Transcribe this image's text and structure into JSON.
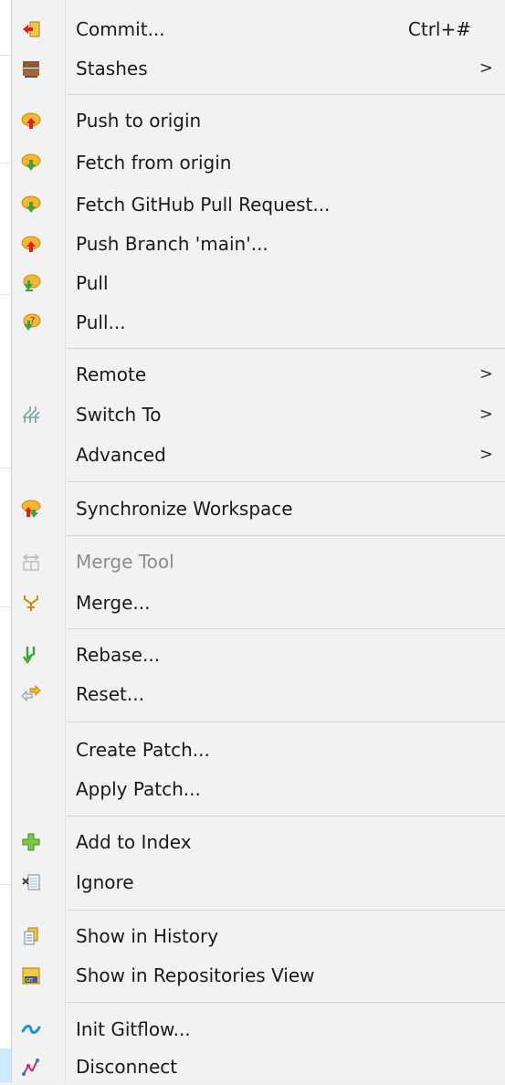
{
  "menu": {
    "items": [
      {
        "label": "Commit...",
        "accel": "Ctrl+#",
        "icon": "commit-icon"
      },
      {
        "label": "Stashes",
        "submenu": true,
        "icon": "stash-icon"
      },
      {
        "label": "Push to origin",
        "icon": "push-icon"
      },
      {
        "label": "Fetch from origin",
        "icon": "fetch-icon"
      },
      {
        "label": "Fetch GitHub Pull Request...",
        "icon": "fetch-pr-icon"
      },
      {
        "label": "Push Branch 'main'...",
        "icon": "push-branch-icon"
      },
      {
        "label": "Pull",
        "icon": "pull-icon"
      },
      {
        "label": "Pull...",
        "icon": "pull-dialog-icon"
      },
      {
        "label": "Remote",
        "submenu": true
      },
      {
        "label": "Switch To",
        "submenu": true,
        "icon": "switch-branch-icon"
      },
      {
        "label": "Advanced",
        "submenu": true
      },
      {
        "label": "Synchronize Workspace",
        "icon": "synchronize-icon"
      },
      {
        "label": "Merge Tool",
        "disabled": true,
        "icon": "merge-tool-icon"
      },
      {
        "label": "Merge...",
        "icon": "merge-icon"
      },
      {
        "label": "Rebase...",
        "icon": "rebase-icon"
      },
      {
        "label": "Reset...",
        "icon": "reset-icon"
      },
      {
        "label": "Create Patch..."
      },
      {
        "label": "Apply Patch..."
      },
      {
        "label": "Add to Index",
        "icon": "add-icon"
      },
      {
        "label": "Ignore",
        "icon": "ignore-icon"
      },
      {
        "label": "Show in History",
        "icon": "history-icon"
      },
      {
        "label": "Show in Repositories View",
        "icon": "repository-icon"
      },
      {
        "label": "Init Gitflow...",
        "icon": "gitflow-icon"
      },
      {
        "label": "Disconnect",
        "icon": "disconnect-icon"
      }
    ],
    "submenu_arrow": ">"
  },
  "colors": {
    "menu_bg": "#f2f2f2",
    "text": "#1a1a1a",
    "disabled_text": "#8c8c8c",
    "separator": "#d6d6d6",
    "cloud": "#f5b731",
    "push_arrow": "#e02020",
    "fetch_arrow": "#3aa53a",
    "gitflow": "#1e90e0"
  }
}
